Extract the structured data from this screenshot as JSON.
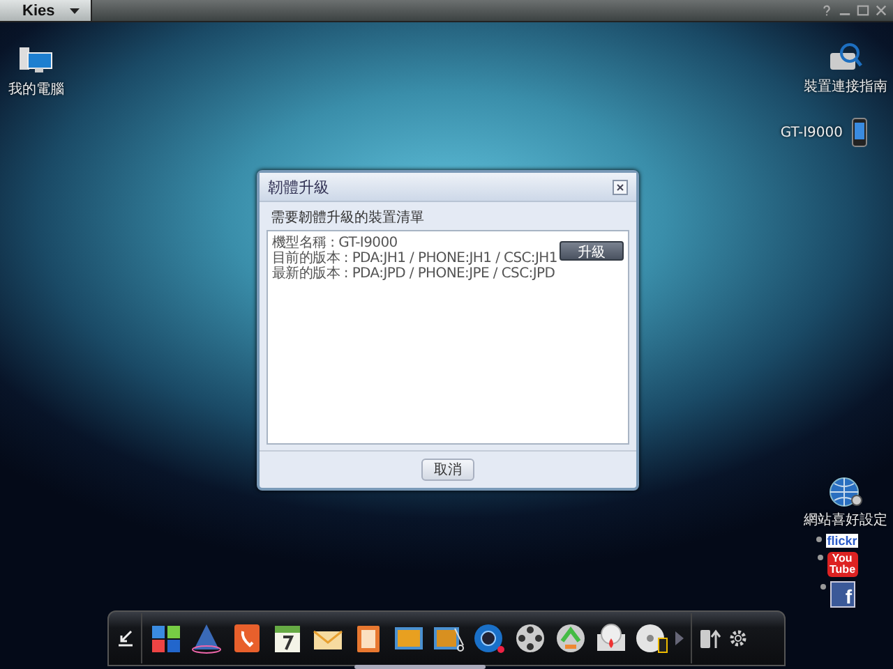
{
  "window": {
    "title": "Kies"
  },
  "desktop_icons": [
    {
      "label": "我的電腦"
    },
    {
      "label": "裝置連接指南"
    },
    {
      "label": "GT-I9000"
    }
  ],
  "dialog": {
    "title": "韌體升級",
    "list_heading": "需要韌體升級的裝置清單",
    "device": {
      "lines": [
        "機型名稱 : GT-I9000",
        "目前的版本 : PDA:JH1 / PHONE:JH1 / CSC:JH1",
        "最新的版本 : PDA:JPD / PHONE:JPE / CSC:JPD"
      ],
      "button": "升級"
    },
    "cancel": "取消"
  },
  "sites": {
    "label": "網站喜好設定",
    "items": [
      {
        "kind": "flickr",
        "text": "flickr"
      },
      {
        "kind": "youtube",
        "text": "You Tube"
      },
      {
        "kind": "facebook",
        "text": "f"
      }
    ]
  }
}
